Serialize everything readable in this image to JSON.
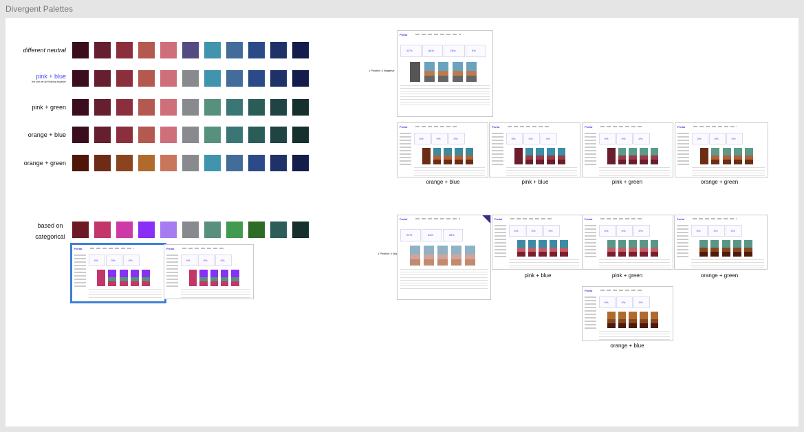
{
  "frame": {
    "title": "Divergent Palettes"
  },
  "palette_rows": [
    {
      "label": "different neutral",
      "sub": "",
      "style": "italic",
      "colors": [
        "#3c0d1c",
        "#661f2e",
        "#8b2f3c",
        "#b4594f",
        "#ce6f79",
        "#534c80",
        "#4094ad",
        "#436c9a",
        "#2a4a88",
        "#1f3267",
        "#141c4c"
      ]
    },
    {
      "label": "pink + blue",
      "sub": "the one we are leaning towards!",
      "style": "blue",
      "colors": [
        "#3c0d1c",
        "#661f2e",
        "#8b2f3c",
        "#b4594f",
        "#ce6f79",
        "#898a8e",
        "#4094ad",
        "#436c9a",
        "#2a4a88",
        "#1f3267",
        "#141c4c"
      ]
    },
    {
      "label": "pink + green",
      "sub": "",
      "style": "plain",
      "colors": [
        "#3c0d1c",
        "#661f2e",
        "#8b2f3c",
        "#b4594f",
        "#ce6f79",
        "#898a8e",
        "#57917e",
        "#3b7677",
        "#2b5d58",
        "#1f4443",
        "#16302e"
      ]
    },
    {
      "label": "orange + blue",
      "sub": "",
      "style": "plain",
      "colors": [
        "#3c0d1c",
        "#661f2e",
        "#8b2f3c",
        "#b4594f",
        "#ce6f79",
        "#898a8e",
        "#57917e",
        "#3b7677",
        "#2b5d58",
        "#1f4443",
        "#16302e"
      ]
    },
    {
      "label": "orange + green",
      "sub": "",
      "style": "plain",
      "colors": [
        "#4e1508",
        "#6e2c17",
        "#8a451f",
        "#b06a2c",
        "#c9765d",
        "#898a8e",
        "#4094ad",
        "#436c9a",
        "#2a4a88",
        "#1f3267",
        "#141c4c"
      ]
    }
  ],
  "categorical": {
    "label": "based on categorical",
    "colors": [
      "#6d1a26",
      "#c2366a",
      "#cd3aa7",
      "#8a2ff5",
      "#a67cf0",
      "#898a8e",
      "#57917e",
      "#419a4e",
      "#2d6c26",
      "#2c5d58",
      "#16302e"
    ]
  },
  "section_notes": {
    "top": "1 Positive 4 Negative",
    "bottom": "1 Positive 4 Negative"
  },
  "captions": {
    "top_row": [
      "orange + blue",
      "pink + blue",
      "pink + green",
      "orange + green"
    ],
    "bottom_row": [
      "pink + blue",
      "pink + green",
      "orange + green"
    ],
    "bottom_extra": "orange + blue"
  },
  "thumb_text": {
    "logo": "Portal",
    "cards": [
      "87%",
      "84%",
      "26%",
      "9%",
      "0%",
      "0%",
      "0%"
    ]
  },
  "bar_schemes": {
    "top_ref": [
      "#666",
      "#bd7a4f",
      "#6aa3c0"
    ],
    "ob": [
      "#6b2d14",
      "#b0633a",
      "#3c8a9a"
    ],
    "pb": [
      "#6a1d2c",
      "#9c3b48",
      "#3b8fa8"
    ],
    "pg": [
      "#6a1d2c",
      "#9c3b48",
      "#5c9a8a"
    ],
    "og": [
      "#6b2d14",
      "#b0633a",
      "#5c9a8a"
    ],
    "pb2": [
      "#7a1f2e",
      "#c45b67",
      "#3c8aa6"
    ],
    "pg2": [
      "#7a1f2e",
      "#c45b67",
      "#5a9686"
    ],
    "og2": [
      "#4e1a0a",
      "#8a451f",
      "#5a9686"
    ],
    "ob2": [
      "#4e1a0a",
      "#8a451f",
      "#b06a2c"
    ],
    "cat": [
      "#c2366a",
      "#57917e",
      "#8a2ff5"
    ],
    "ref2": [
      "#c28a6e",
      "#d4a49a",
      "#8fb2c4"
    ]
  }
}
